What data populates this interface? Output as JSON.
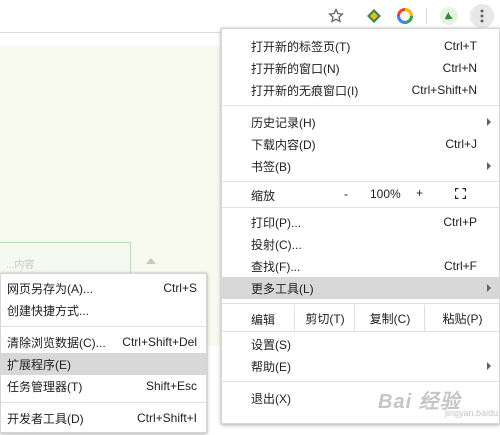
{
  "toolbar": {
    "icons": [
      "star-icon",
      "extension-diamond-icon",
      "color-ring-icon",
      "profile-icon",
      "more-vert-icon"
    ]
  },
  "background": {
    "faint_text": "...内容"
  },
  "main_menu": {
    "new_tab": {
      "label": "打开新的标签页(T)",
      "shortcut": "Ctrl+T"
    },
    "new_window": {
      "label": "打开新的窗口(N)",
      "shortcut": "Ctrl+N"
    },
    "incognito": {
      "label": "打开新的无痕窗口(I)",
      "shortcut": "Ctrl+Shift+N"
    },
    "history": {
      "label": "历史记录(H)"
    },
    "downloads": {
      "label": "下载内容(D)",
      "shortcut": "Ctrl+J"
    },
    "bookmarks": {
      "label": "书签(B)"
    },
    "zoom": {
      "label": "缩放",
      "minus": "-",
      "value": "100%",
      "plus": "+"
    },
    "print": {
      "label": "打印(P)...",
      "shortcut": "Ctrl+P"
    },
    "cast": {
      "label": "投射(C)..."
    },
    "find": {
      "label": "查找(F)...",
      "shortcut": "Ctrl+F"
    },
    "more_tools": {
      "label": "更多工具(L)"
    },
    "edit": {
      "label": "编辑",
      "cut": "剪切(T)",
      "copy": "复制(C)",
      "paste": "粘贴(P)"
    },
    "settings": {
      "label": "设置(S)"
    },
    "help": {
      "label": "帮助(E)"
    },
    "exit": {
      "label": "退出(X)"
    }
  },
  "sub_menu": {
    "save_as": {
      "label": "网页另存为(A)...",
      "shortcut": "Ctrl+S"
    },
    "create_shortcut": {
      "label": "创建快捷方式..."
    },
    "clear_data": {
      "label": "清除浏览数据(C)...",
      "shortcut": "Ctrl+Shift+Del"
    },
    "extensions": {
      "label": "扩展程序(E)"
    },
    "task_manager": {
      "label": "任务管理器(T)",
      "shortcut": "Shift+Esc"
    },
    "dev_tools": {
      "label": "开发者工具(D)",
      "shortcut": "Ctrl+Shift+I"
    }
  },
  "watermark": {
    "text": "Bai 经验",
    "sub": "jingyan.baidu.com"
  },
  "colors": {
    "highlight": "#d8d8d8",
    "separator": "#e0e0e0",
    "text": "#202124"
  }
}
